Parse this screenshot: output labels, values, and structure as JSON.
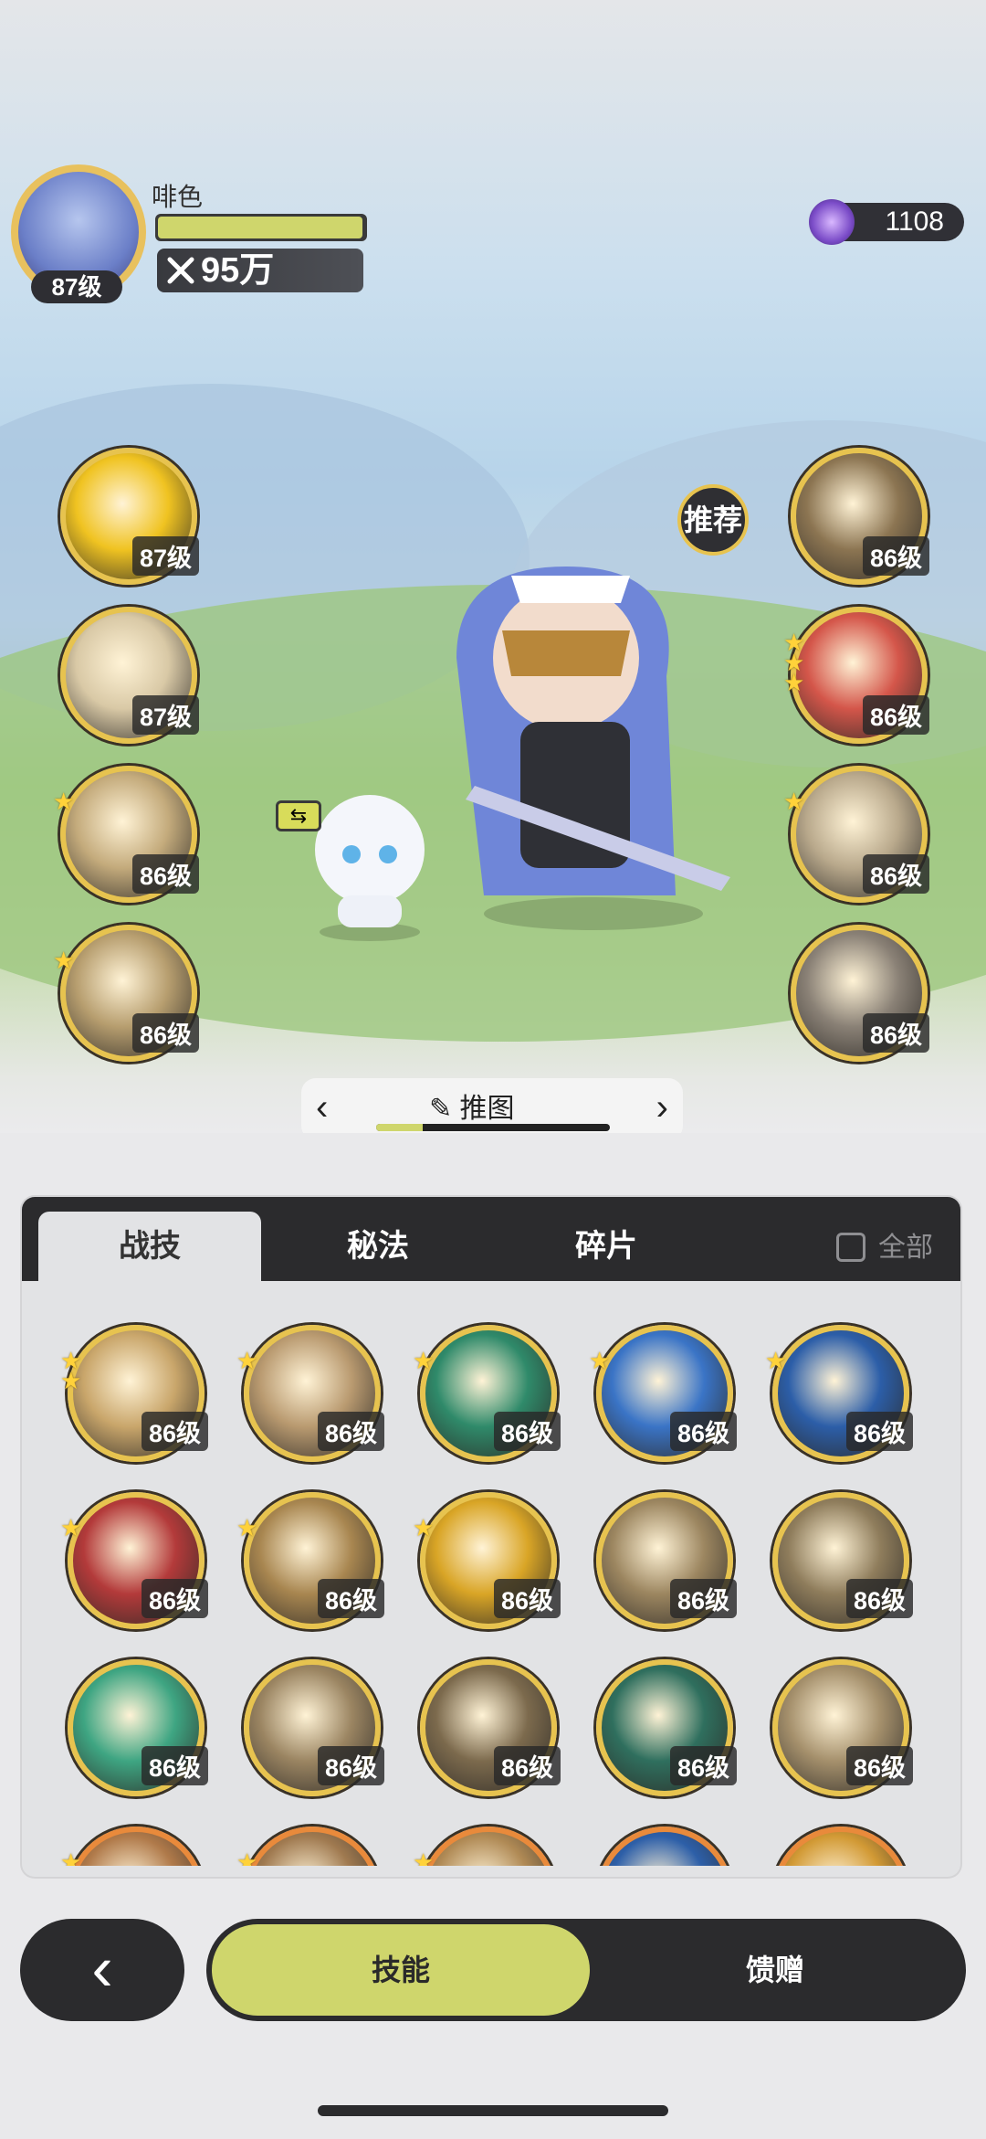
{
  "player": {
    "name": "啡色",
    "level": "87级",
    "power": "95万",
    "hp_fraction": 0.99
  },
  "currency": {
    "amount": "1108",
    "icon": "purple-gem-icon"
  },
  "recommend_label": "推荐",
  "left_skills": [
    {
      "level": "87级",
      "stars": 0,
      "icon": "golden-shield-icon"
    },
    {
      "level": "87级",
      "stars": 0,
      "icon": "swirl-burst-icon"
    },
    {
      "level": "86级",
      "stars": 1,
      "icon": "wind-slash-icon"
    },
    {
      "level": "86级",
      "stars": 1,
      "icon": "blade-strike-icon"
    }
  ],
  "right_skills": [
    {
      "level": "86级",
      "stars": 0,
      "icon": "claw-strike-icon"
    },
    {
      "level": "86级",
      "stars": 3,
      "icon": "red-sword-icon"
    },
    {
      "level": "86级",
      "stars": 1,
      "icon": "piercing-spike-icon"
    },
    {
      "level": "86级",
      "stars": 0,
      "icon": "vortex-fist-icon"
    }
  ],
  "pager": {
    "label": "推图",
    "progress_fraction": 0.2
  },
  "tabs": [
    {
      "label": "战技",
      "active": true
    },
    {
      "label": "秘法",
      "active": false
    },
    {
      "label": "碎片",
      "active": false
    }
  ],
  "all_toggle": {
    "label": "全部",
    "checked": false
  },
  "grid_skills": [
    {
      "level": "86级",
      "stars": 2,
      "color": "#c9a66b"
    },
    {
      "level": "86级",
      "stars": 1,
      "color": "#b99a70"
    },
    {
      "level": "86级",
      "stars": 1,
      "color": "#2f8a6a"
    },
    {
      "level": "86级",
      "stars": 1,
      "color": "#3a74c6"
    },
    {
      "level": "86级",
      "stars": 1,
      "color": "#2c5ea8"
    },
    {
      "level": "86级",
      "stars": 1,
      "color": "#b33a3a"
    },
    {
      "level": "86级",
      "stars": 1,
      "color": "#a88650"
    },
    {
      "level": "86级",
      "stars": 1,
      "color": "#d9a526"
    },
    {
      "level": "86级",
      "stars": 0,
      "color": "#9c8660"
    },
    {
      "level": "86级",
      "stars": 0,
      "color": "#8f7d5c"
    },
    {
      "level": "86级",
      "stars": 0,
      "color": "#3ea582"
    },
    {
      "level": "86级",
      "stars": 0,
      "color": "#9b8562"
    },
    {
      "level": "86级",
      "stars": 0,
      "color": "#7c6a4d"
    },
    {
      "level": "86级",
      "stars": 0,
      "color": "#2f6f5e"
    },
    {
      "level": "86级",
      "stars": 0,
      "color": "#a5906c"
    },
    {
      "level": "",
      "stars": 1,
      "color": "#b07a4a",
      "ring": "orange"
    },
    {
      "level": "",
      "stars": 1,
      "color": "#a07a50",
      "ring": "orange"
    },
    {
      "level": "",
      "stars": 1,
      "color": "#b08a55",
      "ring": "orange"
    },
    {
      "level": "",
      "stars": 0,
      "color": "#2d5fa8",
      "ring": "orange"
    },
    {
      "level": "",
      "stars": 0,
      "color": "#d29a35",
      "ring": "orange"
    }
  ],
  "bottom": {
    "back_label": "‹",
    "skill_label": "技能",
    "gift_label": "馈赠"
  }
}
